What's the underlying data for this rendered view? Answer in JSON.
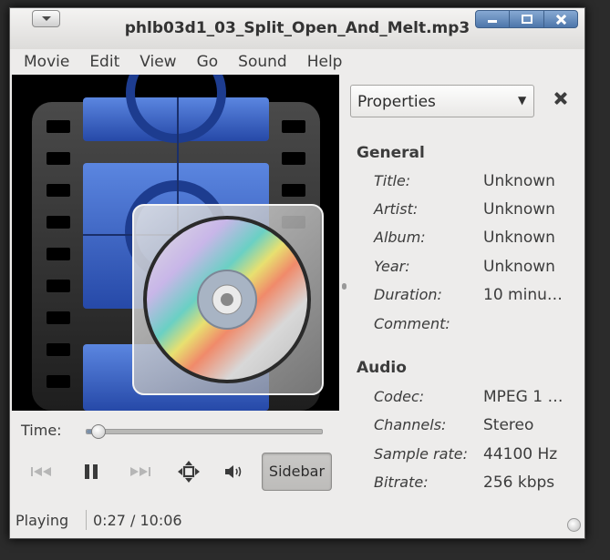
{
  "window": {
    "title": "phlb03d1_03_Split_Open_And_Melt.mp3"
  },
  "menubar": {
    "items": [
      "Movie",
      "Edit",
      "View",
      "Go",
      "Sound",
      "Help"
    ]
  },
  "player": {
    "time_label": "Time:",
    "seek_position": 0.045,
    "sidebar_button": "Sidebar"
  },
  "status": {
    "state": "Playing",
    "time": "0:27 / 10:06"
  },
  "sidebar": {
    "panel_select": "Properties",
    "general": {
      "heading": "General",
      "rows": [
        {
          "key": "Title:",
          "value": "Unknown"
        },
        {
          "key": "Artist:",
          "value": "Unknown"
        },
        {
          "key": "Album:",
          "value": "Unknown"
        },
        {
          "key": "Year:",
          "value": "Unknown"
        },
        {
          "key": "Duration:",
          "value": "10 minu…"
        },
        {
          "key": "Comment:",
          "value": ""
        }
      ]
    },
    "audio": {
      "heading": "Audio",
      "rows": [
        {
          "key": "Codec:",
          "value": "MPEG 1 …"
        },
        {
          "key": "Channels:",
          "value": "Stereo"
        },
        {
          "key": "Sample rate:",
          "value": "44100 Hz"
        },
        {
          "key": "Bitrate:",
          "value": "256 kbps"
        }
      ]
    }
  },
  "icons": {
    "window_menu": "chevron-down-icon",
    "minimize": "minimize-icon",
    "maximize": "maximize-icon",
    "close": "close-icon",
    "previous": "skip-previous-icon",
    "pause": "pause-icon",
    "next": "skip-next-icon",
    "fullscreen": "fullscreen-icon",
    "volume": "volume-icon",
    "artwork": "film-disc-artwork"
  },
  "colors": {
    "titlebar_buttons": "#5a7fb0",
    "window_bg": "#edeceb"
  }
}
